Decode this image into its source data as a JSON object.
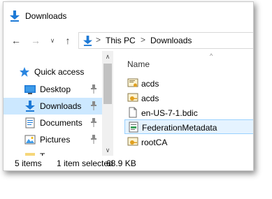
{
  "window": {
    "title": "Downloads"
  },
  "address": {
    "crumbs": [
      "This PC",
      "Downloads"
    ],
    "separator": ">"
  },
  "nav": {
    "back_glyph": "←",
    "forward_glyph": "→",
    "recent_glyph": "∨",
    "up_glyph": "↑",
    "items": [
      {
        "label": "Quick access",
        "icon": "star-icon",
        "pinned": false,
        "selected": false
      },
      {
        "label": "Desktop",
        "icon": "desktop-icon",
        "pinned": true,
        "selected": false
      },
      {
        "label": "Downloads",
        "icon": "download-arrow-icon",
        "pinned": true,
        "selected": true
      },
      {
        "label": "Documents",
        "icon": "documents-icon",
        "pinned": true,
        "selected": false
      },
      {
        "label": "Pictures",
        "icon": "pictures-icon",
        "pinned": true,
        "selected": false
      },
      {
        "label": "T",
        "icon": "folder-icon",
        "pinned": false,
        "selected": false
      }
    ],
    "scroll_up_glyph": "∧",
    "scroll_down_glyph": "∨"
  },
  "list": {
    "sort_glyph": "^",
    "column_name": "Name",
    "files": [
      {
        "name": "acds",
        "icon": "certificate-icon",
        "selected": false
      },
      {
        "name": "acds",
        "icon": "certificate-key-icon",
        "selected": false
      },
      {
        "name": "en-US-7-1.bdic",
        "icon": "file-icon",
        "selected": false
      },
      {
        "name": "FederationMetadata",
        "icon": "xml-document-icon",
        "selected": true
      },
      {
        "name": "rootCA",
        "icon": "certificate-key-icon",
        "selected": false
      }
    ]
  },
  "status": {
    "item_count": "5 items",
    "selected": "1 item selected",
    "size": "68.9 KB"
  },
  "colors": {
    "selection": "#cce8ff",
    "file_selection": "#e5f3ff",
    "accent": "#1e7ad6"
  }
}
